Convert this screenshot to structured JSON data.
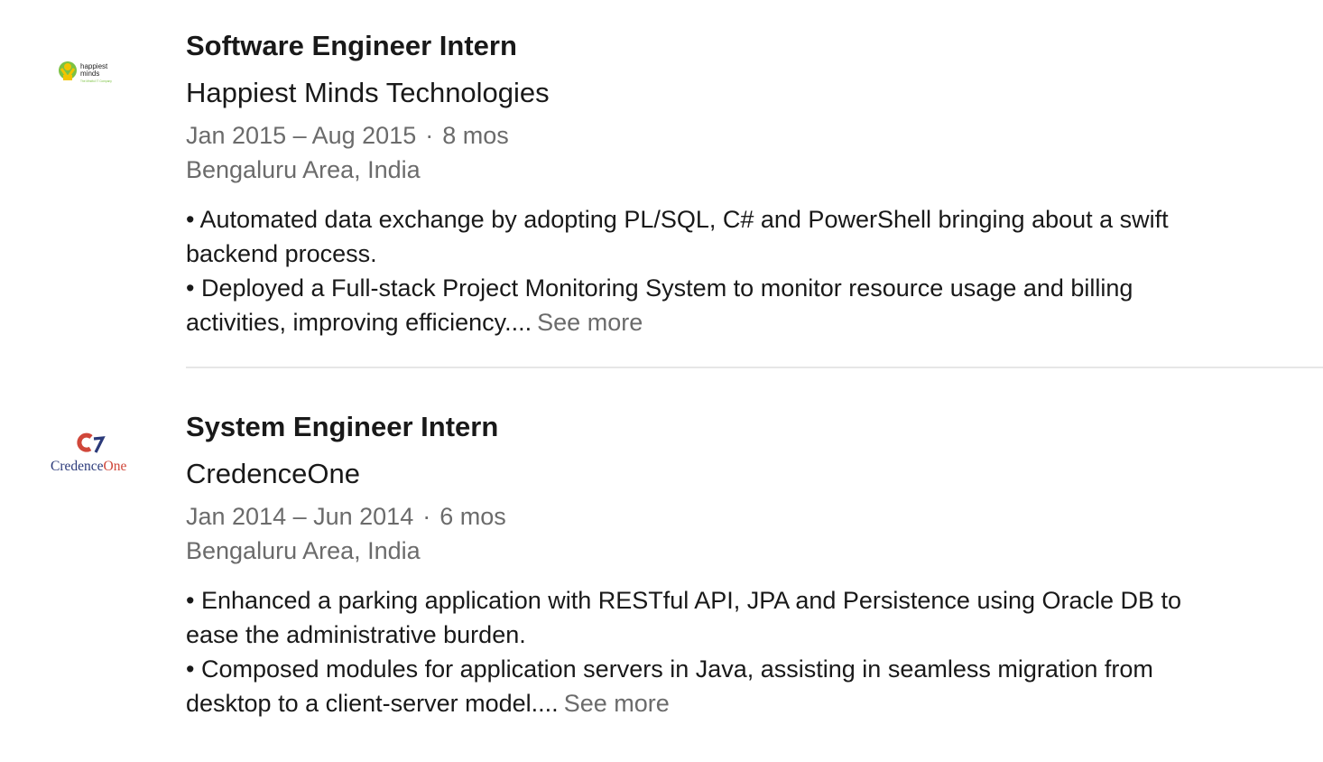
{
  "experience": [
    {
      "logo_name": "Happiest Minds logo",
      "logo_text": [
        "happiest",
        "minds",
        "The Mindful IT Company"
      ],
      "title": "Software Engineer Intern",
      "company": "Happiest Minds Technologies",
      "date_range": "Jan 2015 – Aug 2015",
      "separator": "·",
      "duration": "8 mos",
      "location": "Bengaluru Area, India",
      "description_lines": [
        "• Automated data exchange by adopting PL/SQL, C# and PowerShell bringing about a swift",
        "backend process.",
        "• Deployed a Full-stack Project Monitoring System to monitor resource usage and billing",
        "activities, improving efficiency...."
      ],
      "see_more": "See more"
    },
    {
      "logo_name": "CredenceOne logo",
      "logo_text": [
        "Credence",
        "One"
      ],
      "title": "System Engineer Intern",
      "company": "CredenceOne",
      "date_range": "Jan 2014 – Jun 2014",
      "separator": "·",
      "duration": "6 mos",
      "location": "Bengaluru Area, India",
      "description_lines": [
        "• Enhanced a parking application with RESTful API, JPA and Persistence using Oracle DB to",
        "ease the administrative burden.",
        "• Composed modules for application servers in Java, assisting in seamless migration from",
        "desktop to a client-server model...."
      ],
      "see_more": "See more"
    }
  ],
  "colors": {
    "primary_text": "#191919",
    "secondary_text": "#6b6b6b",
    "divider": "#e6e6e6",
    "credence_blue": "#2b3a7a",
    "credence_red": "#d0473a",
    "hm_green": "#7cc242",
    "hm_yellow": "#f2c400"
  }
}
